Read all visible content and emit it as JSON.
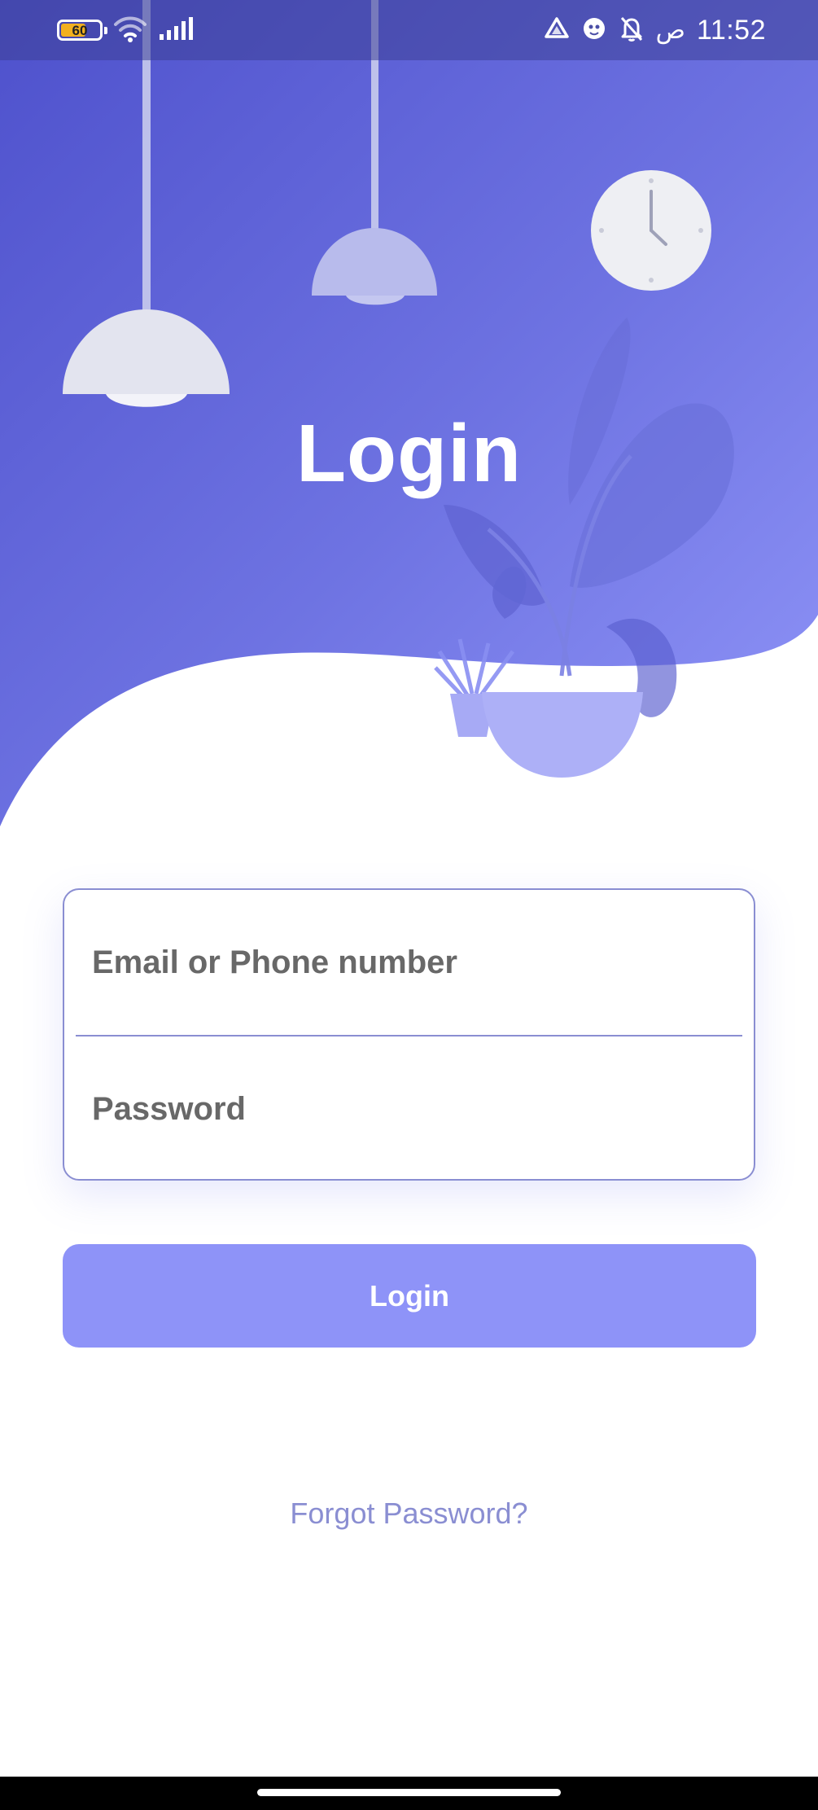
{
  "status_bar": {
    "battery_level": "60",
    "time": "11:52",
    "ampm": "ص",
    "icons": [
      "wifi-icon",
      "signal-icon",
      "drive-icon",
      "assistant-icon",
      "bell-off-icon"
    ]
  },
  "header": {
    "title": "Login"
  },
  "form": {
    "email_placeholder": "Email or Phone number",
    "email_value": "",
    "password_placeholder": "Password",
    "password_value": ""
  },
  "actions": {
    "login_label": "Login",
    "forgot_label": "Forgot Password?"
  },
  "colors": {
    "accent": "#8e93f8",
    "header_gradient_start": "#4f52cc",
    "header_gradient_end": "#8a8ff5",
    "border": "#8a8ed2"
  }
}
